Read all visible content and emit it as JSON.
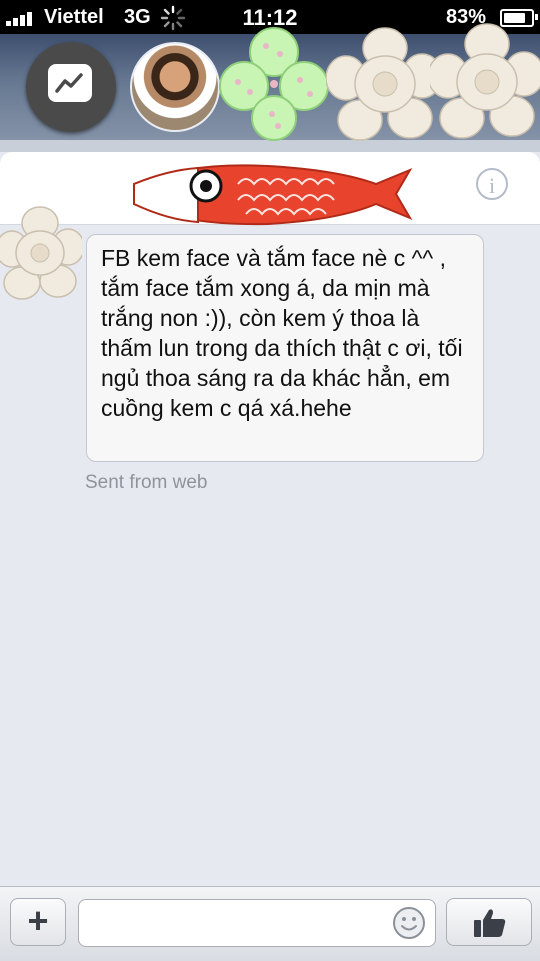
{
  "status_bar": {
    "carrier": "Viettel",
    "network": "3G",
    "time": "11:12",
    "battery_percent": "83%"
  },
  "colors": {
    "status_bar_bg": "#000000",
    "chat_background": "#e6e9f0",
    "koi_red": "#e8432c",
    "bubble_bg": "#f7f7f7"
  },
  "header": {
    "info_label": "i"
  },
  "icons": {
    "messenger": "messenger-icon",
    "info": "info-icon",
    "plus": "plus-icon",
    "emoji": "emoji-icon",
    "like": "thumbs-up-icon"
  },
  "conversation": {
    "messages": [
      {
        "text": "FB kem face và tắm face nè c ^^ , tắm face tắm xong á, da mịn mà trắng non :)), còn kem ý thoa là thấm lun trong da thích thật c ơi, tối ngủ thoa sáng ra da khác hẳn, em cuồng kem c qá xá.hehe",
        "source": "Sent from web"
      }
    ]
  },
  "composer": {
    "plus_label": "+",
    "input_value": ""
  }
}
